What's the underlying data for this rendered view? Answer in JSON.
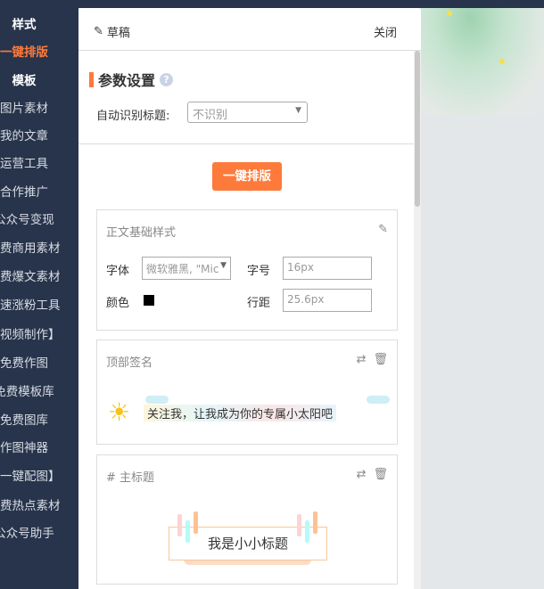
{
  "sidebar": {
    "items": [
      {
        "label": "样式"
      },
      {
        "label": "一键排版"
      },
      {
        "label": "模板"
      },
      {
        "label": "图片素材"
      },
      {
        "label": "我的文章"
      },
      {
        "label": "运营工具"
      },
      {
        "label": "合作推广"
      },
      {
        "label": "公众号变现"
      },
      {
        "label": "免费商用素材"
      },
      {
        "label": "免费爆文素材"
      },
      {
        "label": "快速涨粉工具"
      },
      {
        "label": "【视频制作】"
      },
      {
        "label": "免费作图"
      },
      {
        "label": "免费模板库"
      },
      {
        "label": "免费图库"
      },
      {
        "label": "作图神器"
      },
      {
        "label": "【一键配图】"
      },
      {
        "label": "免费热点素材"
      },
      {
        "label": "公众号助手"
      }
    ],
    "active": "一键排版"
  },
  "header": {
    "draft_label": "草稿",
    "close_label": "关闭"
  },
  "params": {
    "title": "参数设置",
    "help": "?",
    "auto_title_label": "自动识别标题:",
    "auto_title_value": "不识别"
  },
  "action": {
    "one_click_label": "一键排版"
  },
  "base_style": {
    "title": "正文基础样式",
    "font_label": "字体",
    "font_value": "微软雅黑, \"Mic",
    "size_label": "字号",
    "size_value": "16px",
    "color_label": "颜色",
    "color_value": "#000000",
    "line_label": "行距",
    "line_value": "25.6px"
  },
  "top_sign": {
    "title": "顶部签名",
    "text": "关注我，让我成为你的专属小太阳吧"
  },
  "main_title": {
    "title": "# 主标题",
    "text": "我是小小标题"
  },
  "colors": {
    "sidebar": "#27344b",
    "accent": "#fe7a3b"
  }
}
